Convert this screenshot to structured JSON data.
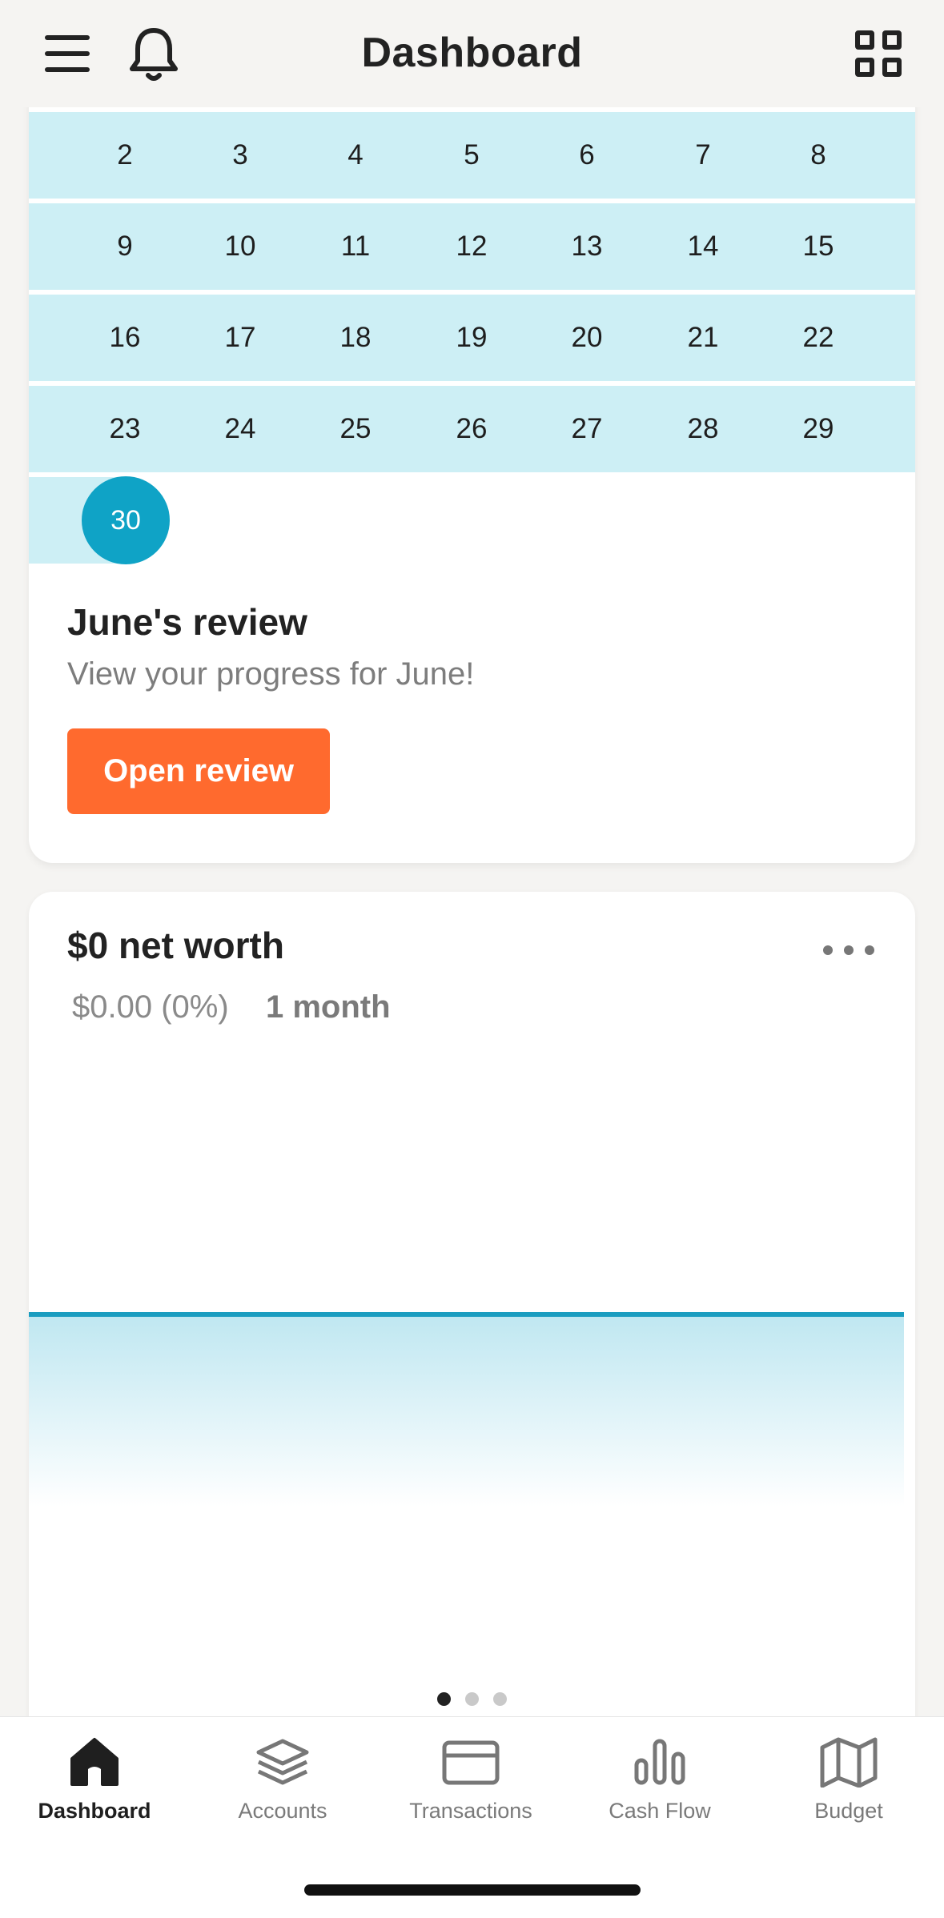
{
  "header": {
    "title": "Dashboard",
    "menu_icon": "hamburger-menu-icon",
    "bell_icon": "bell-icon",
    "grid_icon": "grid-icon"
  },
  "calendar": {
    "rows": [
      [
        "2",
        "3",
        "4",
        "5",
        "6",
        "7",
        "8"
      ],
      [
        "9",
        "10",
        "11",
        "12",
        "13",
        "14",
        "15"
      ],
      [
        "16",
        "17",
        "18",
        "19",
        "20",
        "21",
        "22"
      ],
      [
        "23",
        "24",
        "25",
        "26",
        "27",
        "28",
        "29"
      ]
    ],
    "today": "30",
    "highlight_color": "#cdeff5",
    "today_color": "#0fa3c6"
  },
  "review": {
    "title": "June's review",
    "subtitle": "View your progress for June!",
    "button_label": "Open review",
    "button_color": "#ff6a2e"
  },
  "net_worth": {
    "title": "$0 net worth",
    "change": "$0.00 (0%)",
    "period": "1 month",
    "menu_icon": "more-dots-icon",
    "line_color": "#1a9dc0"
  },
  "pager": {
    "count": 3,
    "active": 0
  },
  "nav": {
    "items": [
      {
        "label": "Dashboard",
        "icon": "home-icon",
        "active": true
      },
      {
        "label": "Accounts",
        "icon": "layers-icon",
        "active": false
      },
      {
        "label": "Transactions",
        "icon": "credit-card-icon",
        "active": false
      },
      {
        "label": "Cash Flow",
        "icon": "bar-chart-icon",
        "active": false
      },
      {
        "label": "Budget",
        "icon": "map-icon",
        "active": false
      }
    ]
  }
}
